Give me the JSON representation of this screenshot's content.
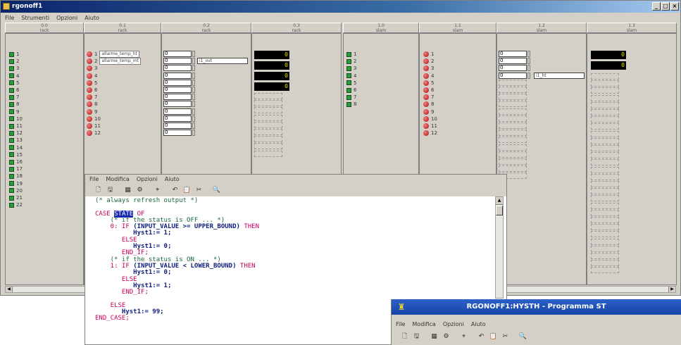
{
  "main_window": {
    "title": "rgonoff1",
    "menu": [
      "File",
      "Strumenti",
      "Opzioni",
      "Aiuto"
    ],
    "modules": [
      {
        "id": "0.0",
        "type": "rack"
      },
      {
        "id": "0.1",
        "type": "rack"
      },
      {
        "id": "0.2",
        "type": "rack"
      },
      {
        "id": "0.3",
        "type": "rack"
      },
      {
        "id": "1.0",
        "type": "slam"
      },
      {
        "id": "1.1",
        "type": "slam"
      },
      {
        "id": "1.2",
        "type": "slam"
      },
      {
        "id": "1.3",
        "type": "slam"
      }
    ],
    "digital_inputs_col1": [
      "1",
      "2",
      "3",
      "4",
      "5",
      "6",
      "7",
      "8",
      "9",
      "10",
      "11",
      "12",
      "13",
      "14",
      "15",
      "16",
      "17",
      "18",
      "19",
      "20",
      "21",
      "22"
    ],
    "digital_inputs_col2": [
      "1",
      "2",
      "3",
      "4",
      "5",
      "6",
      "7",
      "8"
    ],
    "relays_col1": [
      "1",
      "2",
      "3",
      "4",
      "5",
      "6",
      "7",
      "8",
      "9",
      "10",
      "11",
      "12"
    ],
    "relays_col2": [
      "1",
      "2",
      "3",
      "4",
      "5",
      "6",
      "7",
      "8",
      "9",
      "10",
      "11",
      "12"
    ],
    "relay_labels": [
      "allarme_temp_ht",
      "allarme_temp_mt"
    ],
    "inputs_col1": [
      "0",
      "0",
      "0",
      "0",
      "0",
      "0",
      "0",
      "0",
      "0",
      "0",
      "0",
      "0"
    ],
    "input_tag_col1": "i1_ovt",
    "inputs_col2": [
      "0",
      "0",
      "0",
      "0"
    ],
    "input_tag_col2": "i1_ht",
    "displays_col1": [
      "0",
      "0",
      "0",
      "0"
    ],
    "displays_col2": [
      "0",
      "0"
    ]
  },
  "editor": {
    "menu": [
      "File",
      "Modifica",
      "Opzioni",
      "Aiuto"
    ],
    "code": {
      "l1": "(* always refresh output *)",
      "case_kw": "CASE",
      "case_var": "STATE",
      "of_kw": " OF",
      "l3": "    (* if the status is OFF ... *)",
      "l4_label": "    0: ",
      "l4_if": "IF",
      "l4_cond": " (INPUT_VALUE >= UPPER_BOUND) ",
      "l4_then": "THEN",
      "l5": "          Hyst1:= 1;",
      "l6_kw": "       ELSE",
      "l7": "          Hyst1:= 0;",
      "l8_kw": "       END_IF;",
      "l9": "    (* if the status is ON ... *)",
      "l10_label": "    1: ",
      "l10_if": "IF",
      "l10_cond": " (INPUT_VALUE < LOWER_BOUND) ",
      "l10_then": "THEN",
      "l11": "          Hyst1:= 0;",
      "l12_kw": "       ELSE",
      "l13": "          Hyst1:= 1;",
      "l14_kw": "       END_IF;",
      "l16_kw": "    ELSE",
      "l17": "       Hyst1:= 99;",
      "l18_kw": "END_CASE;"
    }
  },
  "st_window": {
    "title": "RGONOFF1:HYSTH - Programma ST",
    "menu": [
      "File",
      "Modifica",
      "Opzioni",
      "Aiuto"
    ]
  },
  "colors": {
    "titlebar": "#0a246a",
    "led_green": "#2a9a3a",
    "relay_red": "#b01010",
    "display_bg": "#000000",
    "display_fg": "#f0e000",
    "keyword": "#c8005a",
    "comment": "#1a6a3a"
  }
}
